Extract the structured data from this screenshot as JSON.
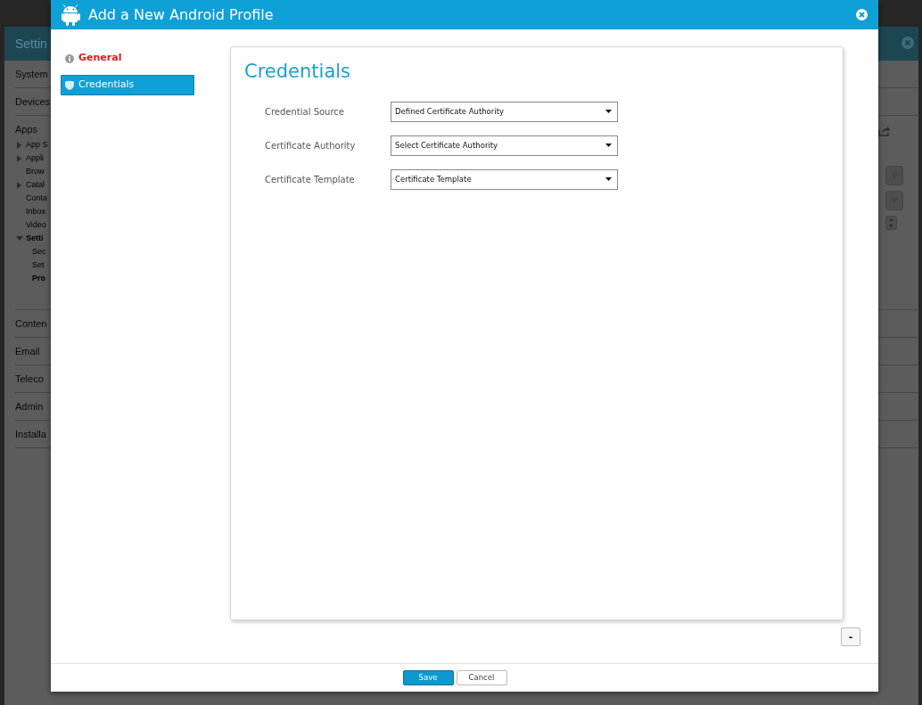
{
  "background": {
    "panel_title": "Settin",
    "nav": [
      {
        "label": "System",
        "kind": "section"
      },
      {
        "label": "Devices",
        "kind": "section"
      },
      {
        "label": "Apps",
        "kind": "section",
        "children": [
          {
            "label": "App S",
            "expanded": false
          },
          {
            "label": "Appli",
            "expanded": false
          },
          {
            "label": "Brow",
            "selected": false
          },
          {
            "label": "Catal",
            "expanded": false
          },
          {
            "label": "Conta",
            "selected": false
          },
          {
            "label": "Inbox",
            "selected": false
          },
          {
            "label": "Video",
            "selected": false
          },
          {
            "label": "Setti",
            "expanded": true,
            "children": [
              {
                "label": "Sec",
                "selected": false
              },
              {
                "label": "Set",
                "selected": false
              },
              {
                "label": "Pro",
                "selected": true
              }
            ]
          }
        ]
      },
      {
        "label": "Conten",
        "kind": "section"
      },
      {
        "label": "Email",
        "kind": "section"
      },
      {
        "label": "Teleco",
        "kind": "section"
      },
      {
        "label": "Admin",
        "kind": "section"
      },
      {
        "label": "Installa",
        "kind": "section"
      }
    ]
  },
  "dialog": {
    "title": "Add a New Android Profile",
    "steps": [
      {
        "label": "General",
        "selected": false,
        "invalid": true
      },
      {
        "label": "Credentials",
        "selected": true,
        "invalid": false
      }
    ],
    "section_title": "Credentials",
    "fields": [
      {
        "label": "Credential Source",
        "value": "Defined Certificate Authority"
      },
      {
        "label": "Certificate Authority",
        "value": "Select Certificate Authority"
      },
      {
        "label": "Certificate Template",
        "value": "Certificate Template"
      }
    ],
    "collapse_button": "-",
    "buttons": [
      {
        "label": "Save",
        "kind": "primary"
      },
      {
        "label": "Cancel",
        "kind": "secondary"
      }
    ]
  }
}
